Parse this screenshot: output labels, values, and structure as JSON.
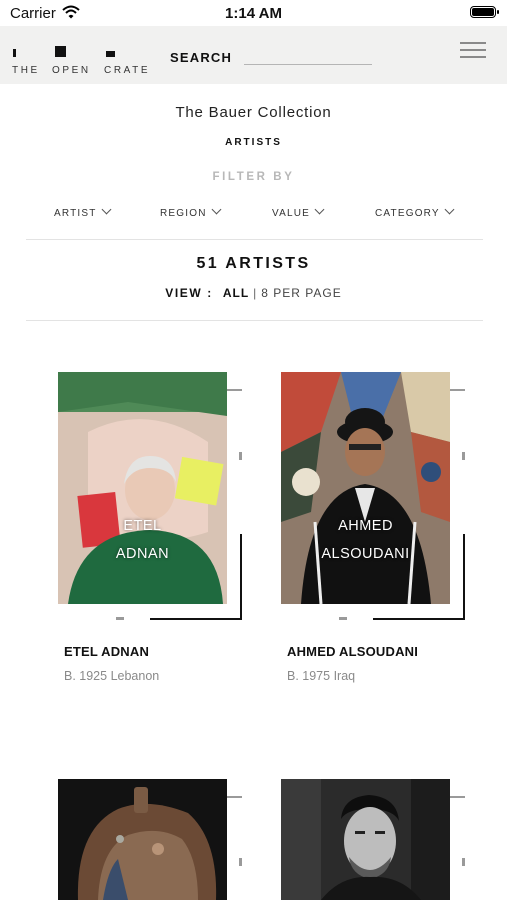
{
  "status": {
    "carrier": "Carrier",
    "time": "1:14 AM"
  },
  "header": {
    "logo_words": [
      "THE",
      "OPEN",
      "CRATE"
    ],
    "search_label": "SEARCH",
    "search_value": "",
    "menu_icon": "hamburger-menu-icon"
  },
  "collection": {
    "title": "The Bauer Collection",
    "section": "ARTISTS"
  },
  "filters": {
    "label": "FILTER BY",
    "items": [
      "ARTIST",
      "REGION",
      "VALUE",
      "CATEGORY"
    ]
  },
  "results": {
    "count": "51 ARTISTS",
    "view_label": "VIEW :",
    "view_all": "ALL",
    "separator": "|",
    "per_page": "8 PER PAGE"
  },
  "artists": [
    {
      "overlay": [
        "ETEL",
        "ADNAN"
      ],
      "name": "ETEL ADNAN",
      "meta": "B. 1925 Lebanon"
    },
    {
      "overlay": [
        "AHMED",
        "ALSOUDANI"
      ],
      "name": "AHMED ALSOUDANI",
      "meta": "B. 1975 Iraq"
    },
    {
      "overlay": [],
      "name": "",
      "meta": ""
    },
    {
      "overlay": [],
      "name": "",
      "meta": ""
    }
  ],
  "colors": {
    "header_bg": "#f1f1f0",
    "filter_label": "#b8b8b8",
    "meta_text": "#8a8a8a"
  }
}
